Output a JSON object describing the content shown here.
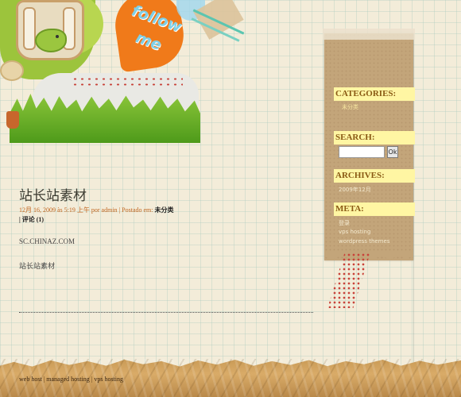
{
  "header": {
    "follow_line1": "follow",
    "follow_line2": "me"
  },
  "post": {
    "title": "站长站素材",
    "meta_date": "12月 16, 2009 às 5:19 上午",
    "meta_by": " por admin | Postado em: ",
    "meta_category": "未分类",
    "meta_comments_label": "| 评论",
    "meta_comments_count": " (1)",
    "body_line1": "SC.CHINAZ.COM",
    "body_line2": "站长站素材"
  },
  "sidebar": {
    "categories_title": "CATEGORIES:",
    "categories_items": [
      "未分类"
    ],
    "search_title": "SEARCH:",
    "search_button": "Ok",
    "archives_title": "ARCHIVES:",
    "archives_items": [
      "2009年12月"
    ],
    "meta_title": "META:",
    "meta_items": [
      "登录",
      "vps hosting",
      "wordpress themes"
    ]
  },
  "footer": {
    "link1": "web host",
    "sep1": " | ",
    "link2": "managed hosting",
    "sep2": " | ",
    "link3": "vps hosting"
  }
}
